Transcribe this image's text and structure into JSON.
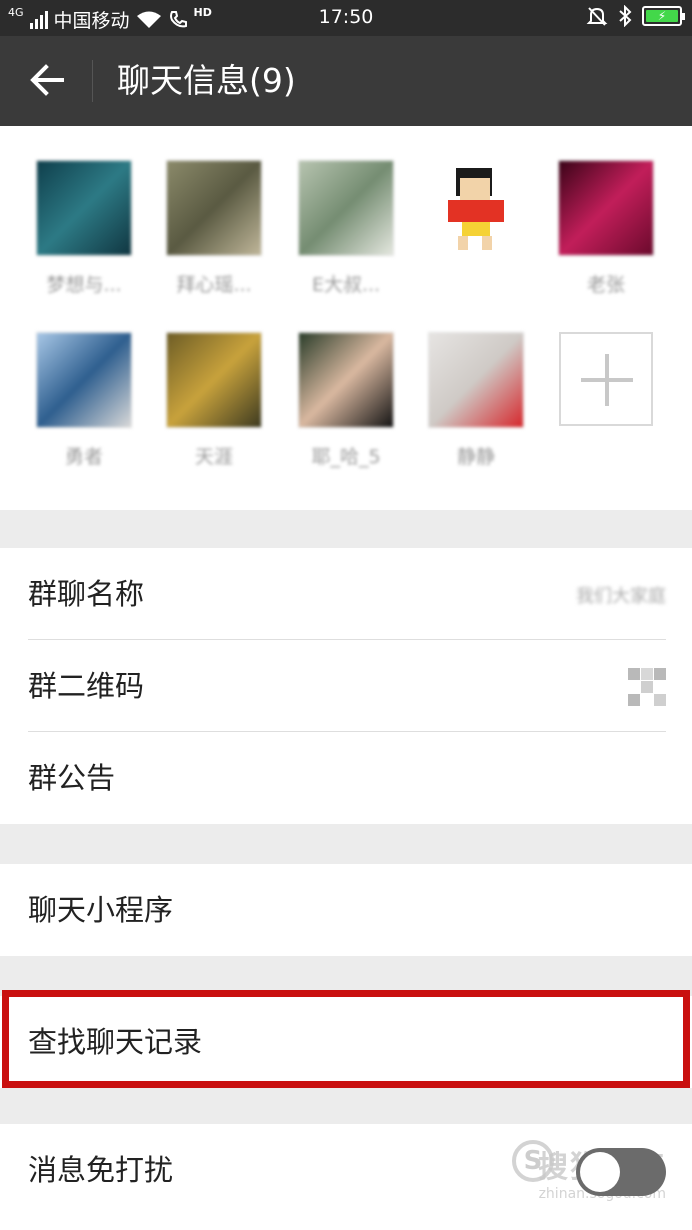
{
  "status_bar": {
    "network": "4G",
    "carrier": "中国移动",
    "hd": "HD",
    "time": "17:50"
  },
  "header": {
    "title": "聊天信息(9)"
  },
  "members": [
    {
      "name": "梦想与...",
      "colors": [
        "#0f3f4c",
        "#2d7a85",
        "#103641"
      ]
    },
    {
      "name": "拜心瑶...",
      "colors": [
        "#8b8a6a",
        "#5a5a42",
        "#c0b79a"
      ]
    },
    {
      "name": "E大叔...",
      "colors": [
        "#b7c4b0",
        "#758d72",
        "#e4e7df"
      ]
    },
    {
      "name": "",
      "colors": [
        "#ffffff",
        "#e33224",
        "#f5d235"
      ]
    },
    {
      "name": "老张",
      "colors": [
        "#3a0418",
        "#c21e5a",
        "#6a0a2c"
      ]
    },
    {
      "name": "勇者",
      "colors": [
        "#a8c7e6",
        "#2f5f8f",
        "#d9d9d9"
      ]
    },
    {
      "name": "天涯",
      "colors": [
        "#6d5d26",
        "#c8a23c",
        "#3d3a20"
      ]
    },
    {
      "name": "耶_哈_5",
      "colors": [
        "#2a3d2a",
        "#d9b8a0",
        "#141414"
      ]
    },
    {
      "name": "静静",
      "colors": [
        "#e6e4e2",
        "#cfcac6",
        "#d6272c"
      ]
    }
  ],
  "menu": {
    "group_name_label": "群聊名称",
    "group_name_value": "我们大家庭",
    "qr_label": "群二维码",
    "notice_label": "群公告",
    "mini_program_label": "聊天小程序",
    "search_history_label": "查找聊天记录",
    "mute_label": "消息免打扰",
    "mute_enabled": false
  },
  "watermark": {
    "logo_letter": "S",
    "text": "搜狗指南",
    "url": "zhinan.sogou.com"
  },
  "colors": {
    "status_bar_bg": "#2c2c2c",
    "title_bar_bg": "#3a3a3a",
    "highlight": "#c9100f",
    "battery_fill": "#43d84a"
  }
}
